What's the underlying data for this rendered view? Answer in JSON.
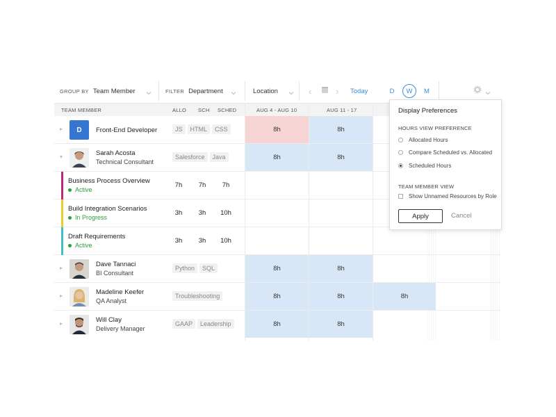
{
  "toolbar": {
    "group_by_label": "GROUP BY",
    "group_by_value": "Team Member",
    "filter_label": "FILTER",
    "filter_value": "Department",
    "location_value": "Location",
    "today_label": "Today",
    "view_day": "D",
    "view_week": "W",
    "view_month": "M"
  },
  "header": {
    "team_member": "TEAM MEMBER",
    "allo": "ALLO",
    "sch": "SCH",
    "sched": "SCHED",
    "week1": "AUG 4 - AUG 10",
    "week2": "AUG 11 - 17"
  },
  "rows": [
    {
      "type": "role",
      "avatar_letter": "D",
      "name": "Front-End Developer",
      "skills": [
        "JS",
        "HTML",
        "CSS"
      ],
      "week1": "8h",
      "week2": "8h"
    },
    {
      "type": "person",
      "name": "Sarah Acosta",
      "role": "Technical Consultant",
      "skills": [
        "Salesforce",
        "Java"
      ],
      "week1": "8h",
      "week2": "8h"
    },
    {
      "type": "task",
      "title": "Business Process Overview",
      "status": "Active",
      "allo": "7h",
      "sch": "7h",
      "sched": "7h"
    },
    {
      "type": "task",
      "title": "Build Integration Scenarios",
      "status": "In Progress",
      "allo": "3h",
      "sch": "3h",
      "sched": "10h"
    },
    {
      "type": "task",
      "title": "Draft Requirements",
      "status": "Active",
      "allo": "3h",
      "sch": "3h",
      "sched": "10h"
    },
    {
      "type": "person",
      "name": "Dave Tannaci",
      "role": "BI Consultant",
      "skills": [
        "Python",
        "SQL"
      ],
      "week1": "8h",
      "week2": "8h"
    },
    {
      "type": "person",
      "name": "Madeline Keefer",
      "role": "QA Analyst",
      "skills": [
        "Troubleshooting"
      ],
      "week1": "8h",
      "week2": "8h",
      "week3": "8h"
    },
    {
      "type": "person",
      "name": "Will Clay",
      "role": "Delivery Manager",
      "skills": [
        "GAAP",
        "Leadership"
      ],
      "week1": "8h",
      "week2": "8h"
    }
  ],
  "popup": {
    "title": "Display Preferences",
    "hours_section": "HOURS VIEW PREFERENCE",
    "options": [
      "Allocated Hours",
      "Compare Scheduled vs. Allocated",
      "Scheduled Hours"
    ],
    "selected_option": "Scheduled Hours",
    "team_section": "TEAM MEMBER VIEW",
    "checkbox_label": "Show Unnamed Resources by Role",
    "apply_label": "Apply",
    "cancel_label": "Cancel"
  },
  "colors": {
    "accent": "#3a8dde",
    "avatar_role": "#3577d0",
    "cell_blue": "#d8e7f8",
    "cell_red": "#f6d4d4",
    "status_green": "#2e9e3a",
    "bar_magenta": "#c0267a",
    "bar_yellow": "#e6cf2a",
    "bar_teal": "#3fc0c8"
  },
  "icons": [
    "chevron-right-icon",
    "chevron-down-icon",
    "calendar-icon",
    "chevron-left-icon",
    "gear-icon"
  ]
}
